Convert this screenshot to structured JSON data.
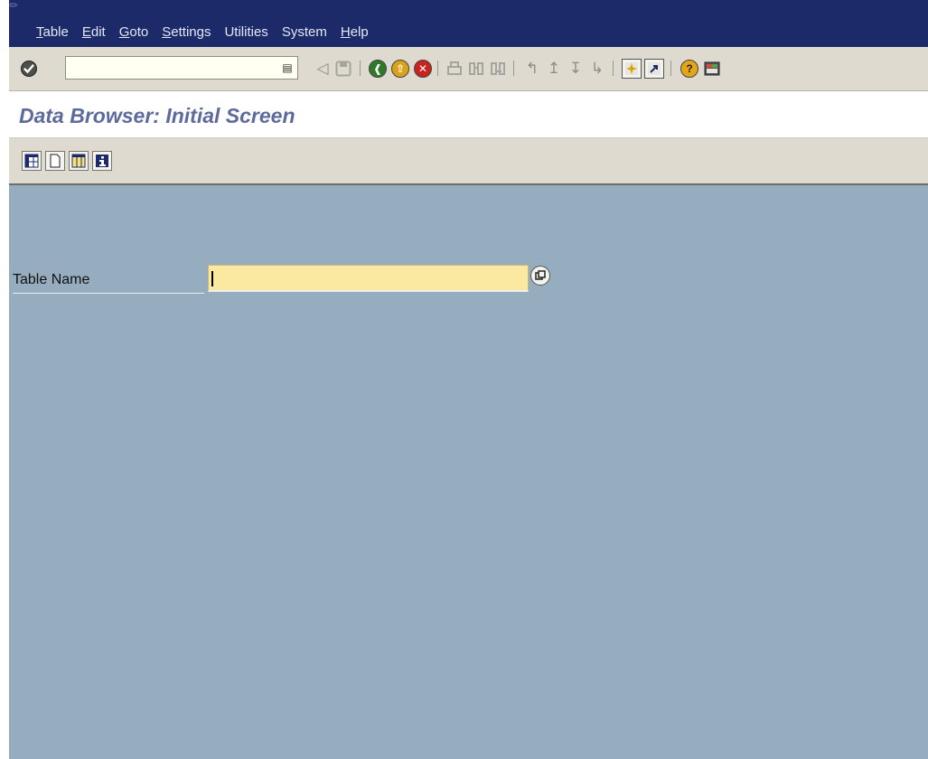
{
  "menu": {
    "items": [
      {
        "first": "T",
        "rest": "able",
        "underline": true
      },
      {
        "first": "E",
        "rest": "dit",
        "underline": true
      },
      {
        "first": "G",
        "rest": "oto",
        "underline": true
      },
      {
        "first": "S",
        "rest": "ettings",
        "underline": true
      },
      {
        "first": "",
        "rest": "Utilities",
        "underline": false
      },
      {
        "first": "S",
        "rest": "ystem",
        "underline": false
      },
      {
        "first": "H",
        "rest": "elp",
        "underline": true
      }
    ]
  },
  "system_toolbar": {
    "command_field_value": "",
    "icons": [
      "enter-icon",
      "command-dropdown-icon",
      "back-arrow-icon",
      "save-icon",
      "back-icon",
      "exit-icon",
      "cancel-icon",
      "print-icon",
      "find-icon",
      "find-next-icon",
      "first-page-icon",
      "previous-page-icon",
      "next-page-icon",
      "last-page-icon",
      "create-session-icon",
      "shortcut-icon",
      "help-icon",
      "layout-menu-icon"
    ]
  },
  "title": {
    "text": "Data Browser: Initial Screen"
  },
  "app_toolbar": {
    "icons": [
      "table-contents-icon",
      "create-entries-icon",
      "table-fields-icon",
      "info-icon"
    ]
  },
  "form": {
    "table_name_label": "Table Name",
    "table_name_value": ""
  },
  "colors": {
    "menu_bg": "#1c2a6a",
    "toolbar_bg": "#dedad0",
    "title_text": "#5d6a9c",
    "content_bg": "#96adc0",
    "input_bg": "#fbe9a2"
  }
}
